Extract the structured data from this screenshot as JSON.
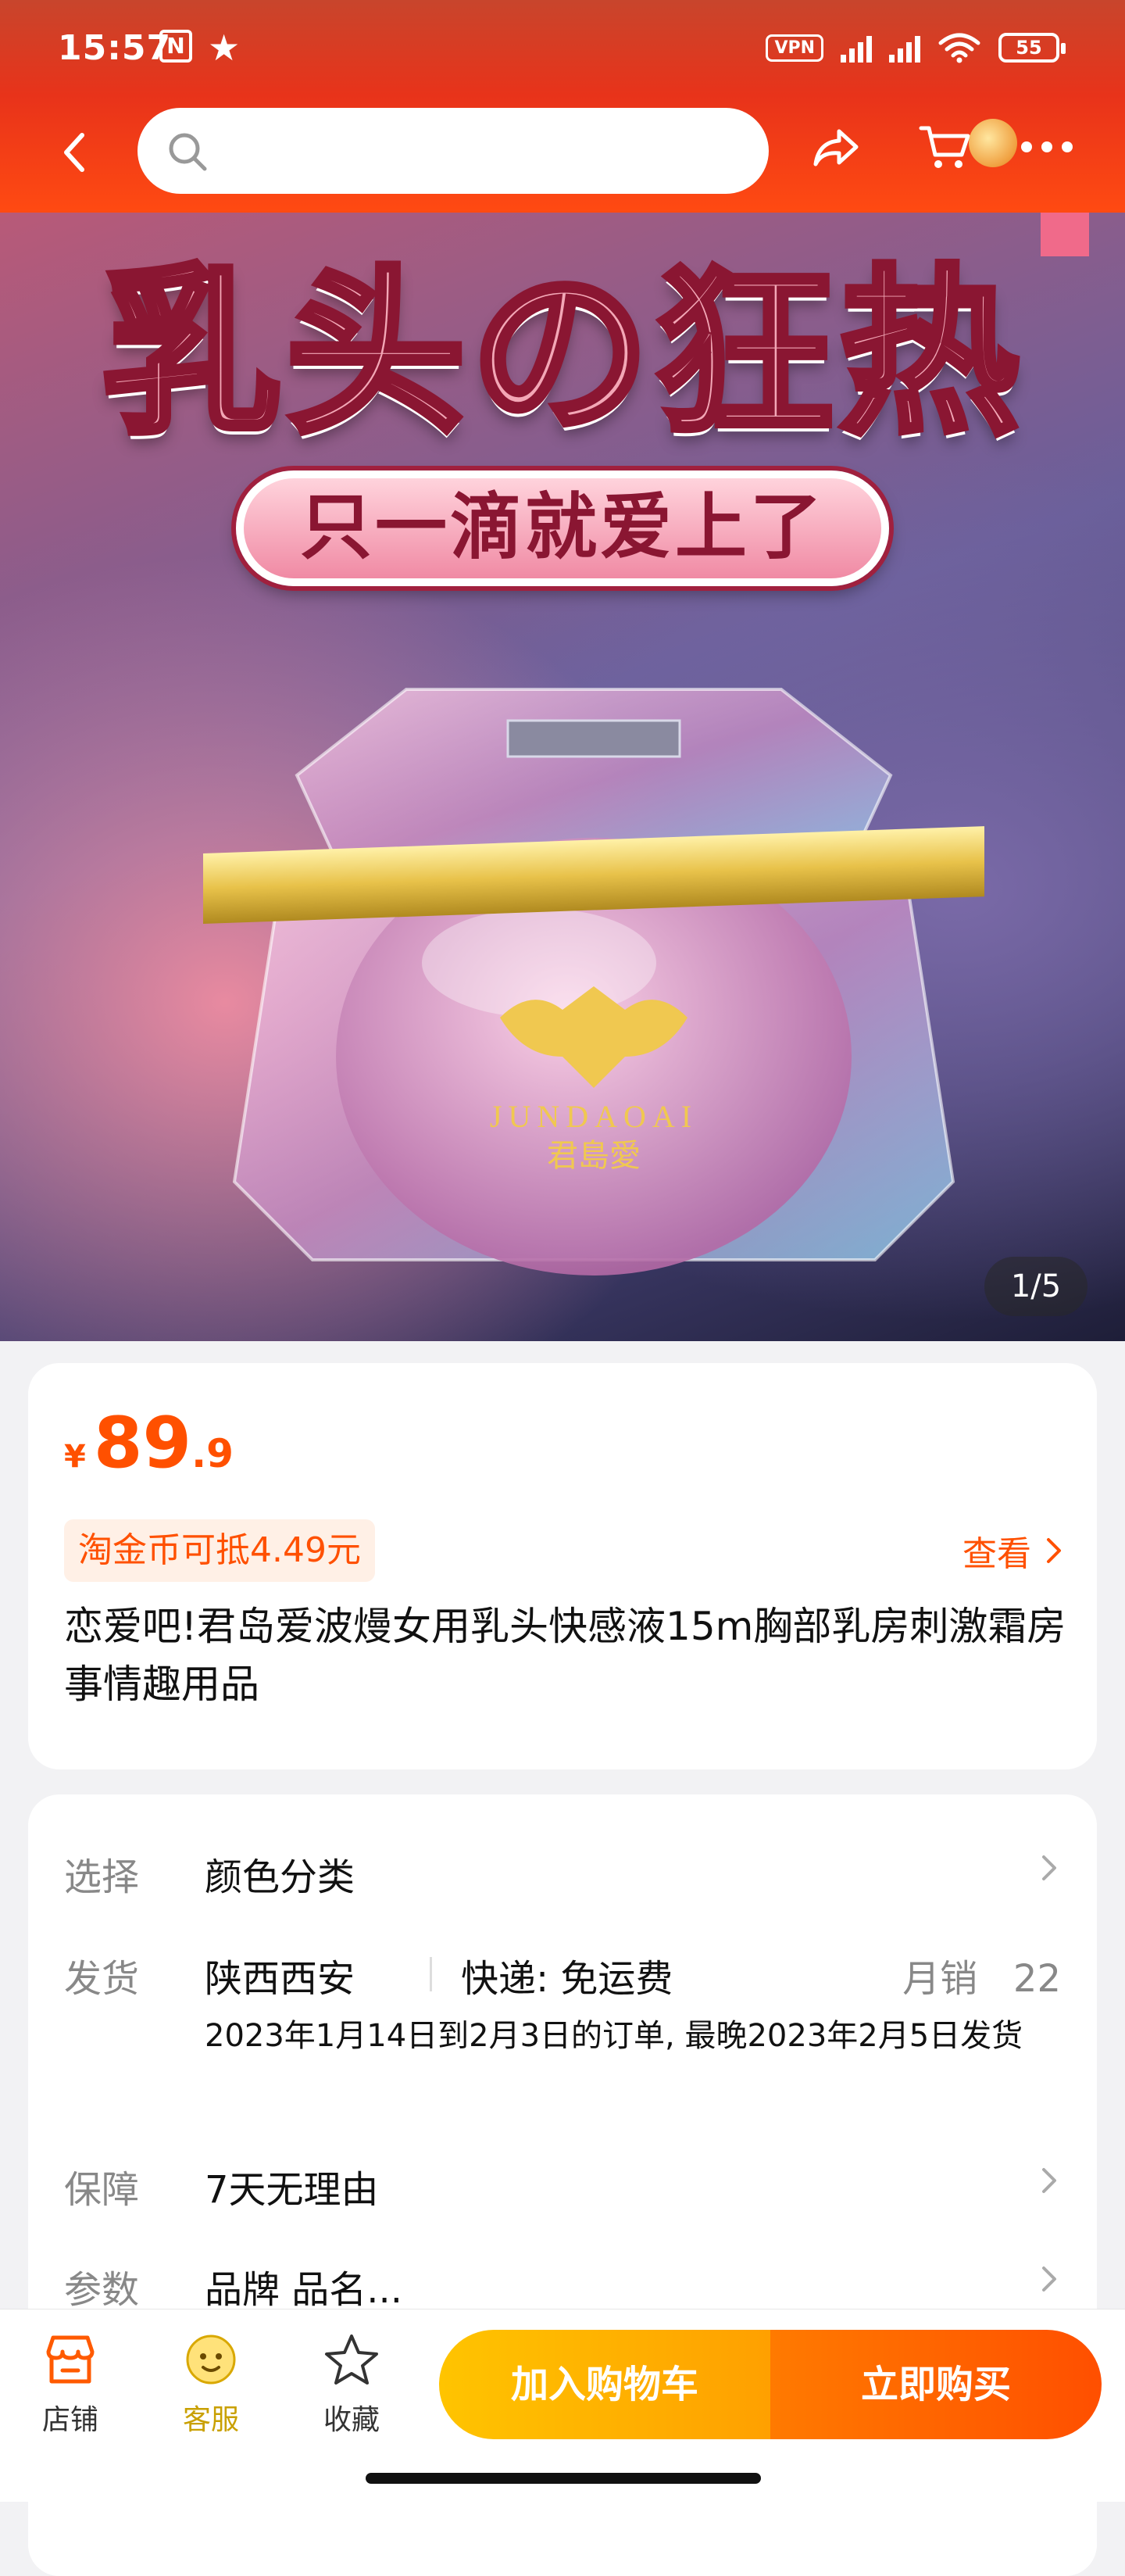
{
  "status_bar": {
    "time": "15:57",
    "n_badge": "N",
    "star": "★",
    "vpn": "VPN",
    "battery": "55"
  },
  "nav": {
    "search_placeholder": "",
    "icons": [
      "back-icon",
      "search-icon",
      "share-icon",
      "cart-icon",
      "more-icon"
    ]
  },
  "hero": {
    "title": "乳头の狂热",
    "subtitle": "只一滴就爱上了",
    "brand_en": "JUNDAOAI",
    "brand_cn": "君島愛",
    "page_indicator": "1/5"
  },
  "product": {
    "currency": "¥",
    "price_int": "89",
    "price_dec": ".9",
    "coin_tag": "淘金币可抵4.49元",
    "view_link": "查看",
    "title": "恋爱吧!君岛爱波熳女用乳头快感液15m胸部乳房刺激霜房事情趣用品"
  },
  "details": {
    "select_label": "选择",
    "select_value": "颜色分类",
    "ship_label": "发货",
    "ship_origin": "陕西西安",
    "ship_fee": "快递: 免运费",
    "sales_label": "月销",
    "sales_value": "22",
    "ship_note": "2023年1月14日到2月3日的订单, 最晚2023年2月5日发货",
    "guarantee_label": "保障",
    "guarantee_value": "7天无理由",
    "params_label": "参数",
    "params_value": "品牌 品名..."
  },
  "bottom_bar": {
    "store_label": "店铺",
    "service_label": "客服",
    "fav_label": "收藏",
    "add_cart_label": "加入购物车",
    "buy_now_label": "立即购买"
  },
  "colors": {
    "accent": "#ff5000",
    "header_red": "#e8331a",
    "cart_yellow": "#ffb000",
    "buy_orange": "#ff5a00"
  }
}
